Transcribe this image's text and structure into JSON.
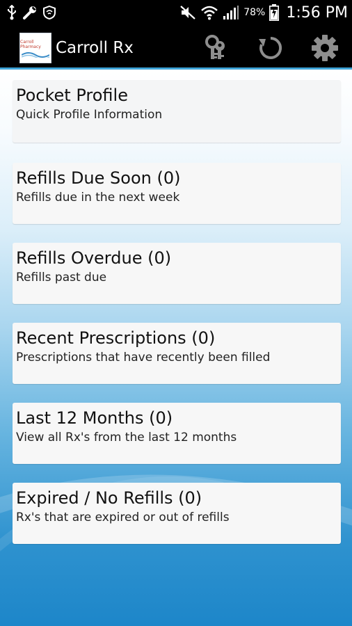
{
  "status_bar": {
    "battery_percent": "78%",
    "time": "1:56 PM",
    "left_icons": [
      "usb-icon",
      "wrench-icon",
      "shield-icon"
    ],
    "right_icons": [
      "mute-icon",
      "wifi-icon",
      "signal-icon",
      "battery-icon"
    ]
  },
  "action_bar": {
    "logo_text": "Carroll Pharmacy",
    "title": "Carroll Rx",
    "icons": [
      "keys-icon",
      "refresh-icon",
      "gear-icon"
    ],
    "accent_color": "#3ea4d8"
  },
  "cards": [
    {
      "title": "Pocket Profile",
      "subtitle": "Quick Profile Information"
    },
    {
      "title": "Refills Due Soon (0)",
      "subtitle": "Refills due in the next week"
    },
    {
      "title": "Refills Overdue (0)",
      "subtitle": "Refills past due"
    },
    {
      "title": "Recent Prescriptions (0)",
      "subtitle": "Prescriptions that have recently been filled"
    },
    {
      "title": "Last 12 Months (0)",
      "subtitle": "View all Rx's from the last 12 months"
    },
    {
      "title": "Expired / No Refills (0)",
      "subtitle": "Rx's that are expired or out of refills"
    }
  ]
}
